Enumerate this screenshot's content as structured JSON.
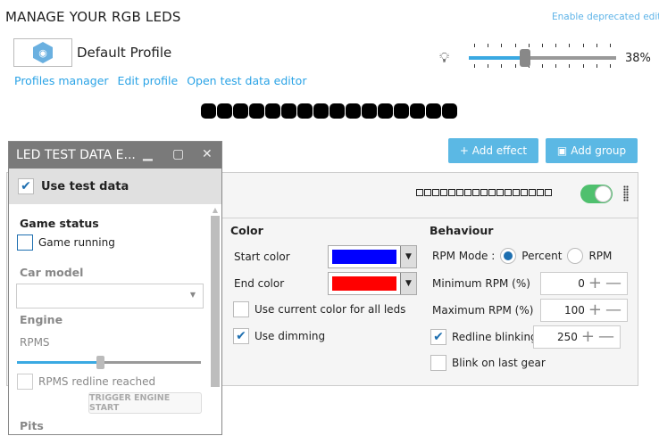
{
  "header": {
    "title": "MANAGE YOUR RGB LEDS",
    "deprecated_link": "Enable deprecated editor"
  },
  "profile": {
    "name": "Default Profile",
    "icon": "gamepad-icon",
    "links": [
      "Profiles manager",
      "Edit profile",
      "Open test data editor"
    ]
  },
  "brightness": {
    "icon": "lightbulb-icon",
    "value_percent": 38,
    "label": "38%"
  },
  "leds": {
    "count": 16,
    "color": "#000000"
  },
  "toolbar": {
    "add_effect": "+ Add effect",
    "add_group": "Add group"
  },
  "effect": {
    "enabled": true,
    "led_slots": 17,
    "color": {
      "heading": "Color",
      "start_label": "Start color",
      "start_color": "#0000ff",
      "end_label": "End color",
      "end_color": "#ff0000",
      "use_current": "Use current color for all leds",
      "use_current_checked": false,
      "dimming": "Use dimming",
      "dimming_checked": true
    },
    "behaviour": {
      "heading": "Behaviour",
      "rpm_mode_label": "RPM Mode :",
      "mode_percent": "Percent",
      "mode_rpm": "RPM",
      "selected_mode": "Percent",
      "min_label": "Minimum RPM (%)",
      "min_value": "0",
      "max_label": "Maximum RPM (%)",
      "max_value": "100",
      "redline_label": "Redline blinking (ms)",
      "redline_value": "250",
      "redline_checked": true,
      "blink_last_gear": "Blink on last gear",
      "blink_checked": false
    }
  },
  "dialog": {
    "title": "LED TEST DATA E...",
    "use_test_data": "Use test data",
    "use_checked": true,
    "game_status": "Game status",
    "game_running": "Game running",
    "car_model": "Car model",
    "car_model_value": "",
    "engine": "Engine",
    "rpms": "RPMS",
    "rpms_value_percent": 45,
    "redline": "RPMS redline reached",
    "trigger": "TRIGGER ENGINE START",
    "pits": "Pits"
  }
}
